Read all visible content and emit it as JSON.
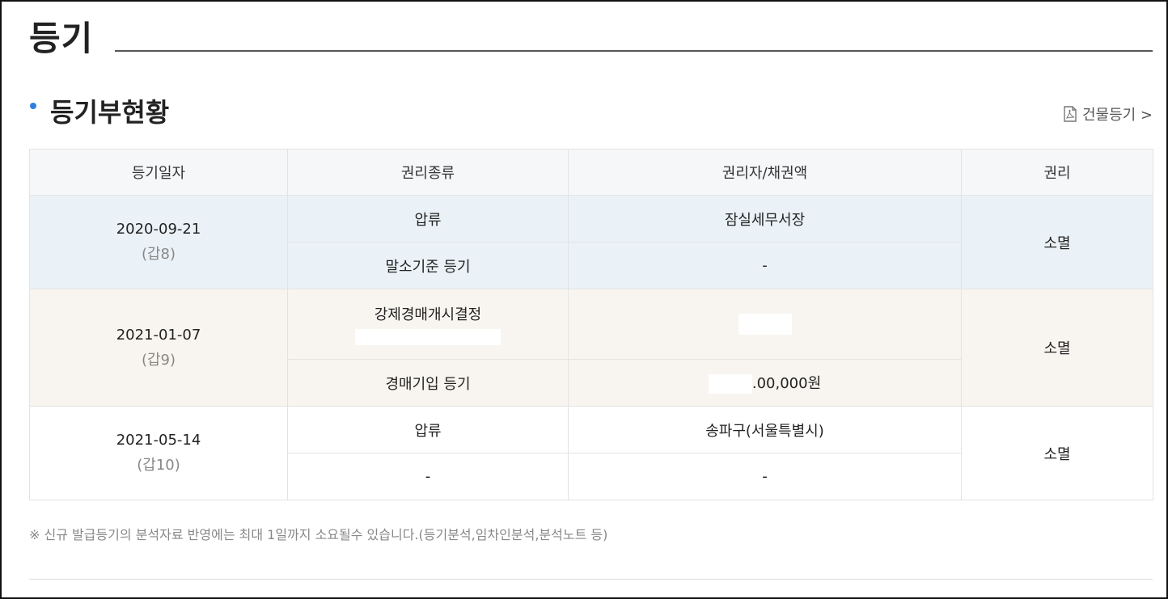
{
  "page": {
    "title": "등기"
  },
  "section": {
    "title": "등기부현황",
    "link_label": "건물등기 >"
  },
  "table": {
    "headers": [
      "등기일자",
      "권리종류",
      "권리자/채권액",
      "권리"
    ],
    "groups": [
      {
        "date": "2020-09-21",
        "ref": "(갑8)",
        "rows": [
          {
            "kind": "압류",
            "holder": "잠실세무서장"
          },
          {
            "kind": "말소기준 등기",
            "holder": "-"
          }
        ],
        "status": "소멸"
      },
      {
        "date": "2021-01-07",
        "ref": "(갑9)",
        "rows": [
          {
            "kind": "강제경매개시결정",
            "holder": ""
          },
          {
            "kind": "경매기입 등기",
            "holder": ".00,000원"
          }
        ],
        "status": "소멸"
      },
      {
        "date": "2021-05-14",
        "ref": "(갑10)",
        "rows": [
          {
            "kind": "압류",
            "holder": "송파구(서울특별시)"
          },
          {
            "kind": "-",
            "holder": "-"
          }
        ],
        "status": "소멸"
      }
    ]
  },
  "note": "※ 신규 발급등기의 분석자료 반영에는 최대 1일까지 소요될수 있습니다.(등기분석,임차인분석,분석노트 등)",
  "icons": {
    "link_icon": "pdf-icon"
  },
  "colors": {
    "accent": "#2f7fe0",
    "row1_bg": "#ebf2f7",
    "row2_bg": "#f8f5f0"
  }
}
